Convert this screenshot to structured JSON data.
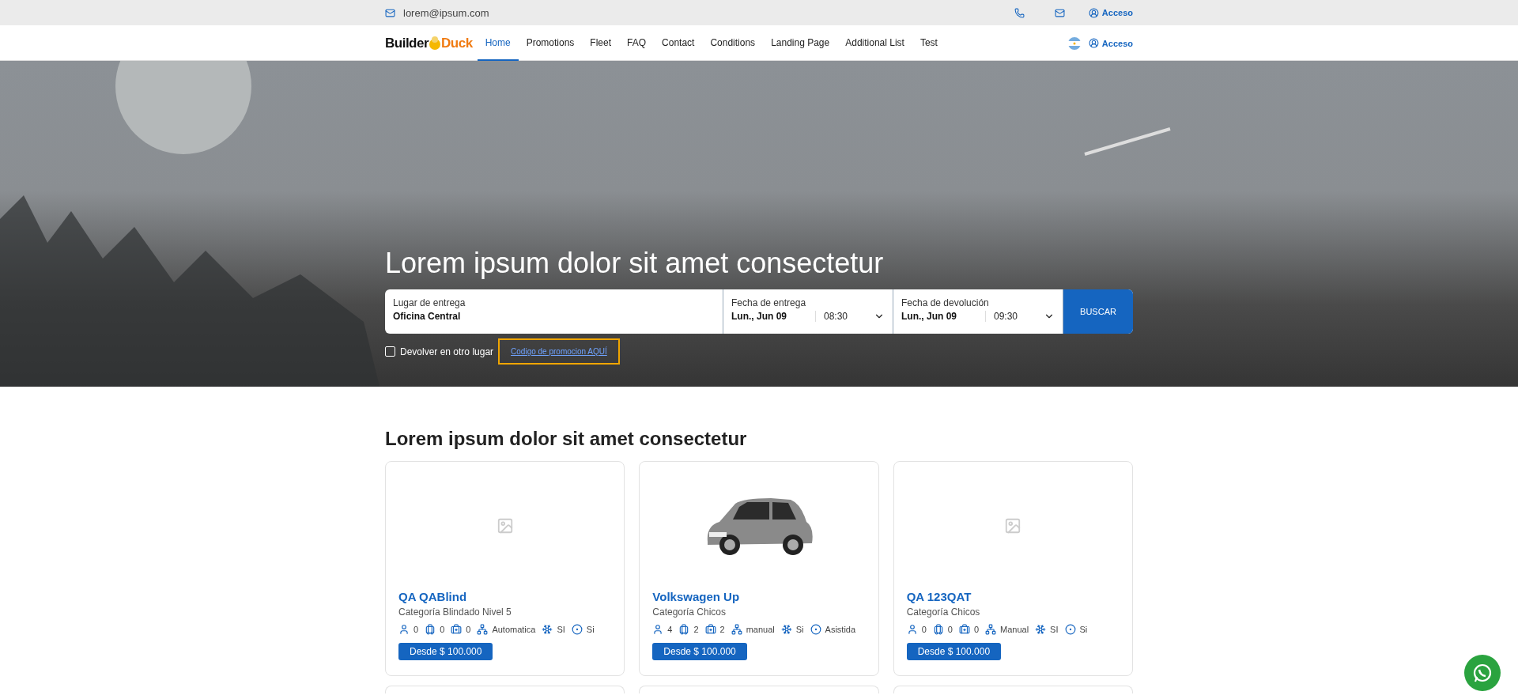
{
  "top_bar": {
    "email": "lorem@ipsum.com",
    "login": "Acceso"
  },
  "nav": {
    "logo_left": "Builder",
    "logo_right": "Duck",
    "items": [
      {
        "label": "Home",
        "selected": true
      },
      {
        "label": "Promotions",
        "selected": false
      },
      {
        "label": "Fleet",
        "selected": false
      },
      {
        "label": "FAQ",
        "selected": false
      },
      {
        "label": "Contact",
        "selected": false
      },
      {
        "label": "Conditions",
        "selected": false
      },
      {
        "label": "Landing Page",
        "selected": false
      },
      {
        "label": "Additional List",
        "selected": false
      },
      {
        "label": "Test",
        "selected": false
      }
    ],
    "login": "Acceso"
  },
  "hero": {
    "title": "Lorem ipsum dolor sit amet consectetur",
    "search": {
      "place_label": "Lugar de entrega",
      "place_value": "Oficina Central",
      "pickup_label": "Fecha de entrega",
      "pickup_date": "Lun., Jun 09",
      "pickup_time": "08:30",
      "return_label": "Fecha de devolución",
      "return_date": "Lun., Jun 09",
      "return_time": "09:30",
      "button": "BUSCAR"
    },
    "return_elsewhere": {
      "label": "Devolver en otro lugar",
      "checked": false
    },
    "promo_link": "Codigo de promocion AQUÍ"
  },
  "section": {
    "title": "Lorem ipsum dolor sit amet consectetur",
    "cards": [
      {
        "has_photo": false,
        "name": "QA QABlind",
        "category": "Categoría Blindado Nivel 5",
        "specs": [
          {
            "kind": "passengers",
            "value": "0"
          },
          {
            "kind": "luggage",
            "value": "0"
          },
          {
            "kind": "bags",
            "value": "0"
          },
          {
            "kind": "transmission",
            "value": "Automatica"
          },
          {
            "kind": "ac",
            "value": "SI"
          },
          {
            "kind": "steering",
            "value": "Si"
          }
        ],
        "price": "Desde $ 100.000"
      },
      {
        "has_photo": true,
        "name": "Volkswagen Up",
        "category": "Categoría Chicos",
        "specs": [
          {
            "kind": "passengers",
            "value": "4"
          },
          {
            "kind": "luggage",
            "value": "2"
          },
          {
            "kind": "bags",
            "value": "2"
          },
          {
            "kind": "transmission",
            "value": "manual"
          },
          {
            "kind": "ac",
            "value": "Si"
          },
          {
            "kind": "steering",
            "value": "Asistida"
          }
        ],
        "price": "Desde $ 100.000"
      },
      {
        "has_photo": false,
        "name": "QA 123QAT",
        "category": "Categoría Chicos",
        "specs": [
          {
            "kind": "passengers",
            "value": "0"
          },
          {
            "kind": "luggage",
            "value": "0"
          },
          {
            "kind": "bags",
            "value": "0"
          },
          {
            "kind": "transmission",
            "value": "Manual"
          },
          {
            "kind": "ac",
            "value": "SI"
          },
          {
            "kind": "steering",
            "value": "Si"
          }
        ],
        "price": "Desde $ 100.000"
      }
    ]
  }
}
